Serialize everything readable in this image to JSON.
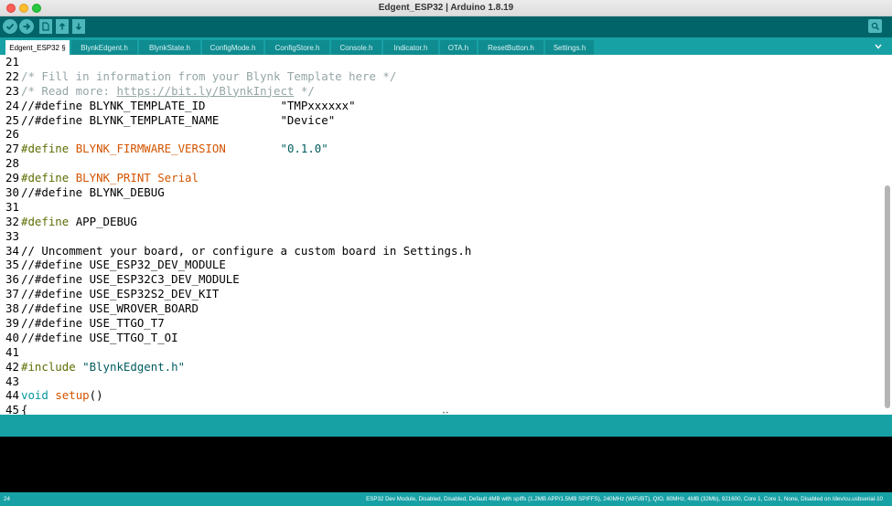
{
  "window": {
    "title": "Edgent_ESP32 | Arduino 1.8.19"
  },
  "toolbar": {
    "verify_icon": "check-icon",
    "upload_icon": "arrow-right-icon",
    "new_icon": "new-file-icon",
    "open_icon": "open-arrow-up-icon",
    "save_icon": "save-arrow-down-icon",
    "serial_icon": "magnifier-icon"
  },
  "tabs": [
    {
      "label": "Edgent_ESP32 §",
      "active": true
    },
    {
      "label": "BlynkEdgent.h"
    },
    {
      "label": "BlynkState.h"
    },
    {
      "label": "ConfigMode.h"
    },
    {
      "label": "ConfigStore.h"
    },
    {
      "label": "Console.h"
    },
    {
      "label": "Indicator.h"
    },
    {
      "label": "OTA.h"
    },
    {
      "label": "ResetButton.h"
    },
    {
      "label": "Settings.h"
    }
  ],
  "code_lines": [
    {
      "n": "21",
      "segs": []
    },
    {
      "n": "22",
      "segs": [
        [
          "cm",
          "/* Fill in information from your Blynk Template here */"
        ]
      ]
    },
    {
      "n": "23",
      "segs": [
        [
          "cm",
          "/* Read more: "
        ],
        [
          "url",
          "https://bit.ly/BlynkInject"
        ],
        [
          "cm",
          " */"
        ]
      ]
    },
    {
      "n": "24",
      "segs": [
        [
          "",
          "//#define BLYNK_TEMPLATE_ID           \"TMPxxxxxx\""
        ]
      ]
    },
    {
      "n": "25",
      "segs": [
        [
          "",
          "//#define BLYNK_TEMPLATE_NAME         \"Device\""
        ]
      ]
    },
    {
      "n": "26",
      "segs": []
    },
    {
      "n": "27",
      "segs": [
        [
          "pp",
          "#define "
        ],
        [
          "kw",
          "BLYNK_FIRMWARE_VERSION"
        ],
        [
          "",
          "        "
        ],
        [
          "str",
          "\"0.1.0\""
        ]
      ]
    },
    {
      "n": "28",
      "segs": []
    },
    {
      "n": "29",
      "segs": [
        [
          "pp",
          "#define "
        ],
        [
          "kw",
          "BLYNK_PRINT"
        ],
        [
          "",
          " "
        ],
        [
          "kw",
          "Serial"
        ]
      ]
    },
    {
      "n": "30",
      "segs": [
        [
          "",
          "//#define BLYNK_DEBUG"
        ]
      ]
    },
    {
      "n": "31",
      "segs": []
    },
    {
      "n": "32",
      "segs": [
        [
          "pp",
          "#define "
        ],
        [
          "",
          "APP_DEBUG"
        ]
      ]
    },
    {
      "n": "33",
      "segs": []
    },
    {
      "n": "34",
      "segs": [
        [
          "",
          "// Uncomment your board, or configure a custom board in Settings.h"
        ]
      ]
    },
    {
      "n": "35",
      "segs": [
        [
          "",
          "//#define USE_ESP32_DEV_MODULE"
        ]
      ]
    },
    {
      "n": "36",
      "segs": [
        [
          "",
          "//#define USE_ESP32C3_DEV_MODULE"
        ]
      ]
    },
    {
      "n": "37",
      "segs": [
        [
          "",
          "//#define USE_ESP32S2_DEV_KIT"
        ]
      ]
    },
    {
      "n": "38",
      "segs": [
        [
          "",
          "//#define USE_WROVER_BOARD"
        ]
      ]
    },
    {
      "n": "39",
      "segs": [
        [
          "",
          "//#define USE_TTGO_T7"
        ]
      ]
    },
    {
      "n": "40",
      "segs": [
        [
          "",
          "//#define USE_TTGO_T_OI"
        ]
      ]
    },
    {
      "n": "41",
      "segs": []
    },
    {
      "n": "42",
      "segs": [
        [
          "pp",
          "#include "
        ],
        [
          "str",
          "\"BlynkEdgent.h\""
        ]
      ]
    },
    {
      "n": "43",
      "segs": []
    },
    {
      "n": "44",
      "segs": [
        [
          "type",
          "void"
        ],
        [
          "",
          " "
        ],
        [
          "fn",
          "setup"
        ],
        [
          "",
          "()"
        ]
      ]
    },
    {
      "n": "45",
      "segs": [
        [
          "",
          "{"
        ]
      ]
    }
  ],
  "status": {
    "line_number": "24",
    "board_info": "ESP32 Dev Module, Disabled, Disabled, Default 4MB with spiffs (1.2MB APP/1.5MB SPIFFS), 240MHz (WiFi/BT), QIO, 80MHz, 4MB (32Mb), 921600, Core 1, Core 1, None, Disabled on /dev/cu.usbserial-10"
  },
  "colors": {
    "toolbar_bg": "#006468",
    "tab_strip_bg": "#17a1a5",
    "button_bg": "#4db7bb",
    "comment": "#95a5a6",
    "preprocessor": "#5e6d03",
    "keyword": "#d35400",
    "string": "#005c5f",
    "type": "#00979c"
  }
}
